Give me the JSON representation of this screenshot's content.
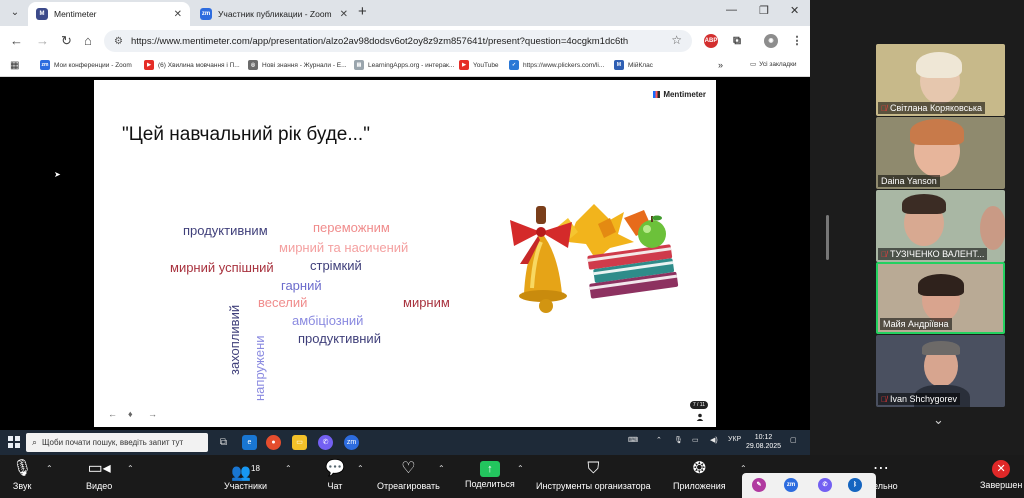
{
  "browser": {
    "tabs": [
      {
        "title": "Mentimeter",
        "active": true
      },
      {
        "title": "Участник публикации - Zoom",
        "active": false
      }
    ],
    "url": "https://www.mentimeter.com/app/presentation/alzo2av98dodsv6ot2oy8z9zm857641t/present?question=4ocgkm1dc6th",
    "bookmarks": [
      "Мои конференции - Zoom",
      "(6) Хвилина мовчання і П...",
      "Нові знання - Журнали - Е...",
      "LearningApps.org - интерак...",
      "YouTube",
      "https://www.plickers.com/li...",
      "МійКлас"
    ],
    "all_bookmarks": "Усі закладки"
  },
  "slide": {
    "brand": "Mentimeter",
    "question": "\"Цей навчальний рік буде...\"",
    "words": [
      {
        "text": "продуктивним",
        "color": "#3f3f7a"
      },
      {
        "text": "переможним",
        "color": "#f08c8c"
      },
      {
        "text": "мирний та насичений",
        "color": "#f4a0a0"
      },
      {
        "text": "мирний успішний",
        "color": "#a8323e"
      },
      {
        "text": "стрімкий",
        "color": "#3f3f7a"
      },
      {
        "text": "гарний",
        "color": "#6c6ccc"
      },
      {
        "text": "веселий",
        "color": "#f08c8c"
      },
      {
        "text": "мирним",
        "color": "#a8323e"
      },
      {
        "text": "амбіціозний",
        "color": "#8a8ae0"
      },
      {
        "text": "продуктивний",
        "color": "#3f3f7a"
      },
      {
        "text": "захопливий",
        "color": "#3f3f7a"
      },
      {
        "text": "напружени",
        "color": "#8a8ae0"
      }
    ],
    "counter": "7 / 11"
  },
  "taskbar": {
    "search_placeholder": "Щоби почати пошук, введіть запит тут",
    "lang": "УКР",
    "time": "10:12",
    "date": "29.08.2025"
  },
  "participants": [
    {
      "name": "Світлана Коряковська",
      "muted": true,
      "bg": "#c7b98a"
    },
    {
      "name": "Daina Yanson",
      "muted": false,
      "bg": "#8f8a6e"
    },
    {
      "name": "ТУЗІЧЕНКО ВАЛЕНТ...",
      "muted": true,
      "bg": "#a9b7a4"
    },
    {
      "name": "Майя Андріївна",
      "muted": false,
      "bg": "#b9aa95"
    },
    {
      "name": "Ivan Shchygorev",
      "muted": true,
      "bg": "#4a5060"
    }
  ],
  "zoom_controls": {
    "audio": "Звук",
    "video": "Видео",
    "participants": "Участники",
    "participants_count": "18",
    "chat": "Чат",
    "react": "Отреагировать",
    "share": "Поделиться",
    "host_tools": "Инструменты организатора",
    "apps": "Приложения",
    "more_partial": "ительно",
    "end": "Завершен"
  }
}
